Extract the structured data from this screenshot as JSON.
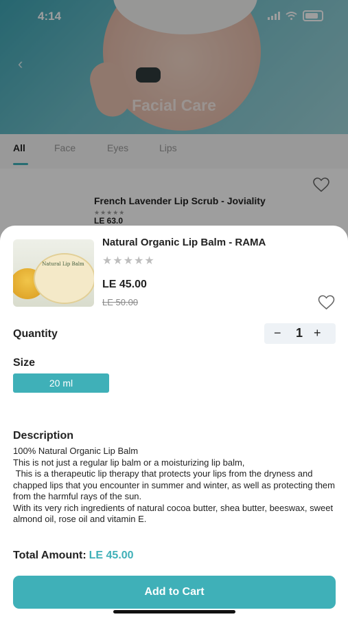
{
  "status": {
    "time": "4:14"
  },
  "hero": {
    "title": "Facial Care"
  },
  "tabs": [
    {
      "label": "All"
    },
    {
      "label": "Face"
    },
    {
      "label": "Eyes"
    },
    {
      "label": "Lips"
    }
  ],
  "list_item": {
    "name": "French Lavender Lip Scrub - Joviality",
    "rating_stars": "★★★★★",
    "price": "LE 63.0"
  },
  "product": {
    "name": "Natural Organic Lip Balm - RAMA",
    "rating_stars": "★★★★★",
    "price": "LE 45.00",
    "old_price": "LE 50.00",
    "jar_label": "Natural Lip Balm"
  },
  "quantity": {
    "label": "Quantity",
    "minus": "−",
    "value": "1",
    "plus": "+"
  },
  "size": {
    "label": "Size",
    "selected": "20 ml"
  },
  "description": {
    "label": "Description",
    "text": "100% Natural Organic Lip Balm\nThis is not just a regular lip balm or a moisturizing lip balm,\n This is a therapeutic lip therapy that protects your lips from the dryness and chapped lips that you encounter in summer and winter, as well as protecting them from the harmful rays of the sun.\nWith its very rich ingredients of natural cocoa butter, shea butter, beeswax, sweet almond oil, rose oil and vitamin E."
  },
  "total": {
    "label": "Total Amount:",
    "value": "LE 45.00"
  },
  "cart_button": "Add to Cart",
  "colors": {
    "accent": "#3fb0b8",
    "overlay": "rgba(0,0,0,0.38)"
  }
}
